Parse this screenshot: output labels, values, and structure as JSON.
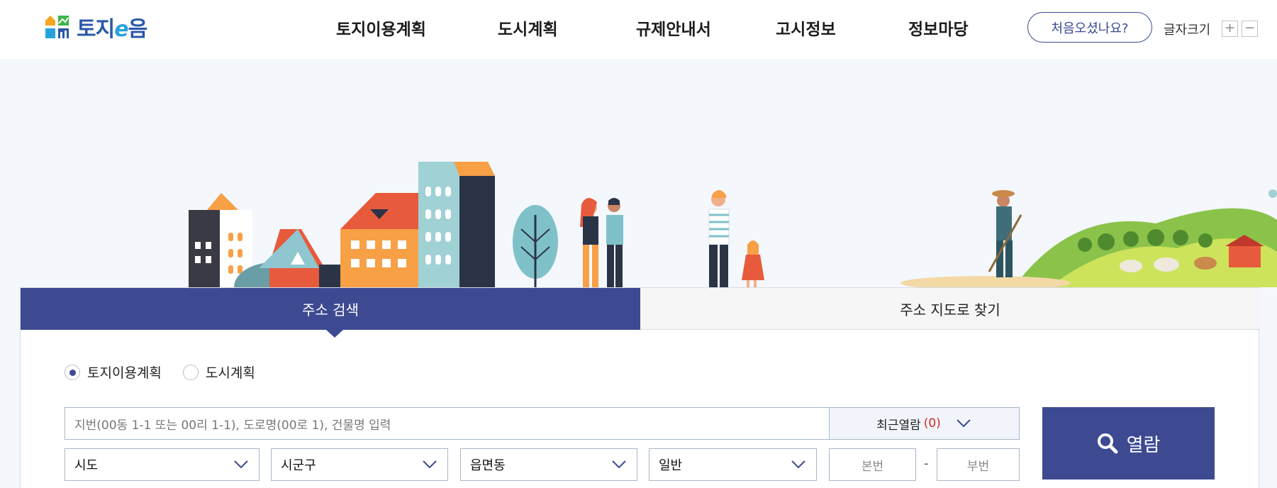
{
  "header": {
    "logo_text_a": "토지",
    "logo_text_e": "e",
    "logo_text_b": "음",
    "nav": [
      {
        "label": "토지이용계획"
      },
      {
        "label": "도시계획"
      },
      {
        "label": "규제안내서"
      },
      {
        "label": "고시정보"
      },
      {
        "label": "정보마당"
      }
    ],
    "first_visit_label": "처음오셨나요?",
    "font_size_label": "글자크기",
    "font_plus": "+",
    "font_minus": "−"
  },
  "tabs": [
    {
      "label": "주소 검색",
      "active": true
    },
    {
      "label": "주소 지도로 찾기",
      "active": false
    }
  ],
  "radios": [
    {
      "label": "토지이용계획",
      "checked": true
    },
    {
      "label": "도시계획",
      "checked": false
    }
  ],
  "search": {
    "placeholder": "지번(00동 1-1 또는 00리 1-1), 도로명(00로 1), 건물명 입력",
    "recent_label": "최근열람",
    "recent_count": "(0)",
    "view_label": "열람"
  },
  "selects": [
    {
      "value": "시도"
    },
    {
      "value": "시군구"
    },
    {
      "value": "읍면동"
    },
    {
      "value": "일반"
    }
  ],
  "number_fields": {
    "main_placeholder": "본번",
    "sub_placeholder": "부번",
    "separator": "-"
  },
  "colors": {
    "primary": "#3d4a92",
    "accent_red": "#d62525",
    "logo_blue": "#2a58a8"
  }
}
